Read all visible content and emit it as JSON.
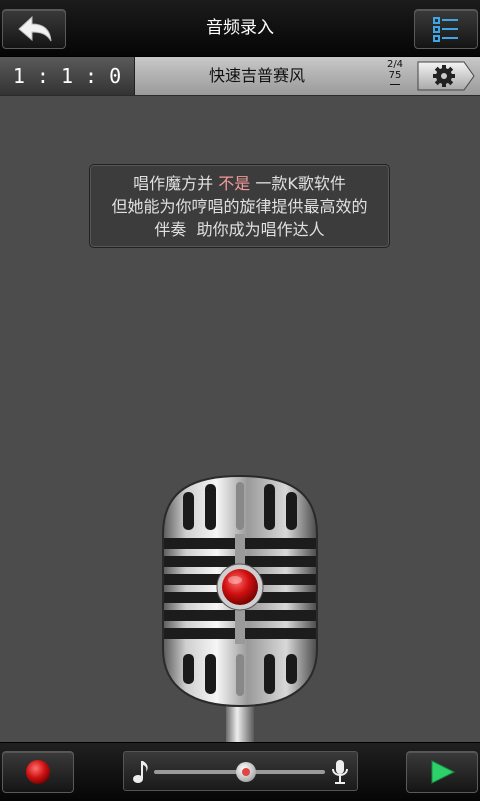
{
  "header": {
    "title": "音频录入",
    "back_icon": "back-arrow-icon",
    "menu_icon": "list-menu-icon"
  },
  "subbar": {
    "counter": "1 : 1 : 0",
    "song_name": "快速吉普赛风",
    "time_signature_top": "2/4",
    "tempo": "75",
    "settings_icon": "gear-icon"
  },
  "tip": {
    "line1_before": "唱作魔方并",
    "line1_highlight": "不是",
    "line1_after": "一款K歌软件",
    "line2": "但她能为你哼唱的旋律提供最高效的",
    "line3": "伴奏  助你成为唱作达人",
    "highlight_color": "#f19a9a"
  },
  "bottom": {
    "record_icon": "record-icon",
    "play_icon": "play-icon",
    "slider_left_icon": "music-note-icon",
    "slider_right_icon": "microphone-icon",
    "slider_position": 0.54
  }
}
